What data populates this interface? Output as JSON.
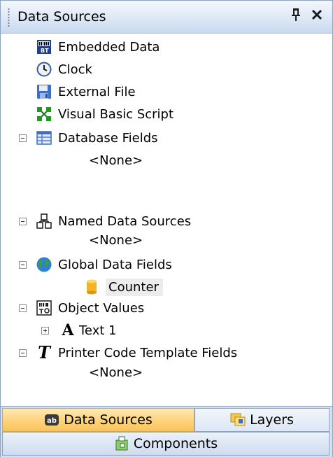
{
  "header": {
    "title": "Data Sources",
    "pin_glyph": "†",
    "close_glyph": "×"
  },
  "tree": {
    "embedded": {
      "label": "Embedded Data",
      "icon": "embedded-data-icon"
    },
    "clock": {
      "label": "Clock",
      "icon": "clock-icon"
    },
    "external": {
      "label": "External File",
      "icon": "floppy-disk-icon"
    },
    "vbscript": {
      "label": "Visual Basic Script",
      "icon": "script-flow-icon"
    },
    "database": {
      "label": "Database Fields",
      "icon": "database-table-icon",
      "child": "<None>"
    },
    "named": {
      "label": "Named Data Sources",
      "icon": "named-sources-icon",
      "child": "<None>"
    },
    "global": {
      "label": "Global Data Fields",
      "icon": "globe-icon",
      "child_label": "Counter",
      "child_icon": "cylinder-icon"
    },
    "objects": {
      "label": "Object Values",
      "icon": "object-values-icon",
      "child_label": "Text 1",
      "child_icon": "text-a-icon"
    },
    "printer": {
      "label": "Printer Code Template Fields",
      "icon": "template-t-icon",
      "child": "<None>"
    }
  },
  "tabs": {
    "data_sources": "Data Sources",
    "layers": "Layers",
    "components": "Components"
  },
  "colors": {
    "active_tab": "#ffd27a",
    "header_bg": "#dde8f6",
    "border": "#8ea3bf"
  }
}
